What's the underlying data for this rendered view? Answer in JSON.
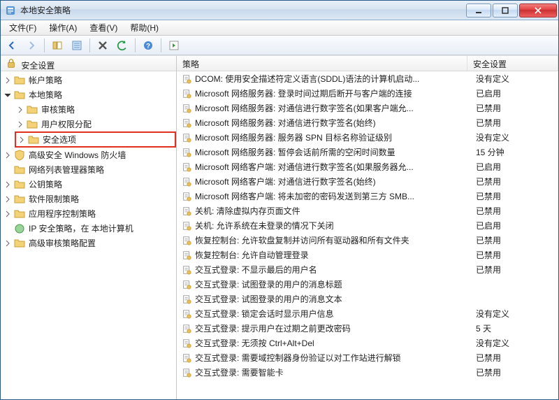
{
  "window": {
    "title": "本地安全策略"
  },
  "menu": {
    "file": "文件(F)",
    "action": "操作(A)",
    "view": "查看(V)",
    "help": "帮助(H)"
  },
  "toolbar": {
    "back": "back",
    "forward": "forward",
    "up": "up",
    "props": "props",
    "refresh": "refresh",
    "help": "help"
  },
  "tree": {
    "header": "安全设置",
    "root": "安全设置",
    "nodes": {
      "account": "帐户策略",
      "local": "本地策略",
      "audit": "审核策略",
      "ura": "用户权限分配",
      "secopt": "安全选项",
      "wfas": "高级安全 Windows 防火墙",
      "nlmp": "网络列表管理器策略",
      "pk": "公钥策略",
      "srp": "软件限制策略",
      "appctrl": "应用程序控制策略",
      "ipsec": "IP 安全策略，在 本地计算机",
      "advaudit": "高级审核策略配置"
    }
  },
  "list": {
    "col_policy": "策略",
    "col_setting": "安全设置",
    "rows": [
      {
        "policy": "DCOM: 使用安全描述符定义语言(SDDL)语法的计算机启动...",
        "setting": "没有定义"
      },
      {
        "policy": "Microsoft 网络服务器: 登录时间过期后断开与客户端的连接",
        "setting": "已启用"
      },
      {
        "policy": "Microsoft 网络服务器: 对通信进行数字签名(如果客户端允...",
        "setting": "已禁用"
      },
      {
        "policy": "Microsoft 网络服务器: 对通信进行数字签名(始终)",
        "setting": "已禁用"
      },
      {
        "policy": "Microsoft 网络服务器: 服务器 SPN 目标名称验证级别",
        "setting": "没有定义"
      },
      {
        "policy": "Microsoft 网络服务器: 暂停会话前所需的空闲时间数量",
        "setting": "15 分钟"
      },
      {
        "policy": "Microsoft 网络客户端: 对通信进行数字签名(如果服务器允...",
        "setting": "已启用"
      },
      {
        "policy": "Microsoft 网络客户端: 对通信进行数字签名(始终)",
        "setting": "已禁用"
      },
      {
        "policy": "Microsoft 网络客户端: 将未加密的密码发送到第三方 SMB...",
        "setting": "已禁用"
      },
      {
        "policy": "关机: 清除虚拟内存页面文件",
        "setting": "已禁用"
      },
      {
        "policy": "关机: 允许系统在未登录的情况下关闭",
        "setting": "已启用"
      },
      {
        "policy": "恢复控制台: 允许软盘复制并访问所有驱动器和所有文件夹",
        "setting": "已禁用"
      },
      {
        "policy": "恢复控制台: 允许自动管理登录",
        "setting": "已禁用"
      },
      {
        "policy": "交互式登录: 不显示最后的用户名",
        "setting": "已禁用"
      },
      {
        "policy": "交互式登录: 试图登录的用户的消息标题",
        "setting": ""
      },
      {
        "policy": "交互式登录: 试图登录的用户的消息文本",
        "setting": ""
      },
      {
        "policy": "交互式登录: 锁定会话时显示用户信息",
        "setting": "没有定义"
      },
      {
        "policy": "交互式登录: 提示用户在过期之前更改密码",
        "setting": "5 天"
      },
      {
        "policy": "交互式登录: 无须按 Ctrl+Alt+Del",
        "setting": "没有定义"
      },
      {
        "policy": "交互式登录: 需要域控制器身份验证以对工作站进行解锁",
        "setting": "已禁用"
      },
      {
        "policy": "交互式登录: 需要智能卡",
        "setting": "已禁用"
      }
    ]
  }
}
